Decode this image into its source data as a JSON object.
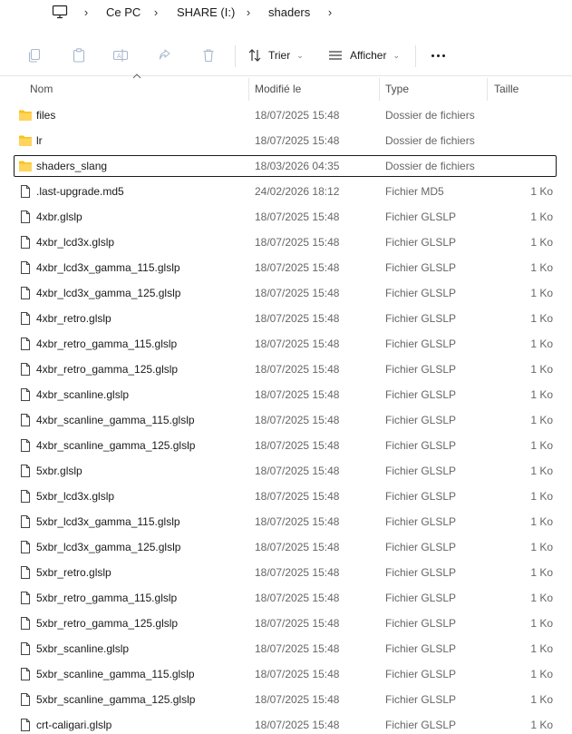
{
  "breadcrumb": {
    "segments": [
      "Ce PC",
      "SHARE (I:)",
      "shaders"
    ]
  },
  "toolbar": {
    "sort_label": "Trier",
    "view_label": "Afficher"
  },
  "columns": {
    "name": "Nom",
    "modified": "Modifié le",
    "type": "Type",
    "size": "Taille"
  },
  "colors": {
    "folder": "#F8C21C",
    "selection_border": "#1a1a1a",
    "secondary_text": "#666666"
  },
  "files": [
    {
      "kind": "folder",
      "name": "files",
      "modified": "18/07/2025 15:48",
      "type": "Dossier de fichiers",
      "size": ""
    },
    {
      "kind": "folder",
      "name": "lr",
      "modified": "18/07/2025 15:48",
      "type": "Dossier de fichiers",
      "size": ""
    },
    {
      "kind": "folder",
      "name": "shaders_slang",
      "modified": "18/03/2026 04:35",
      "type": "Dossier de fichiers",
      "size": "",
      "selected": true
    },
    {
      "kind": "file",
      "name": ".last-upgrade.md5",
      "modified": "24/02/2026 18:12",
      "type": "Fichier MD5",
      "size": "1 Ko"
    },
    {
      "kind": "file",
      "name": "4xbr.glslp",
      "modified": "18/07/2025 15:48",
      "type": "Fichier GLSLP",
      "size": "1 Ko"
    },
    {
      "kind": "file",
      "name": "4xbr_lcd3x.glslp",
      "modified": "18/07/2025 15:48",
      "type": "Fichier GLSLP",
      "size": "1 Ko"
    },
    {
      "kind": "file",
      "name": "4xbr_lcd3x_gamma_115.glslp",
      "modified": "18/07/2025 15:48",
      "type": "Fichier GLSLP",
      "size": "1 Ko"
    },
    {
      "kind": "file",
      "name": "4xbr_lcd3x_gamma_125.glslp",
      "modified": "18/07/2025 15:48",
      "type": "Fichier GLSLP",
      "size": "1 Ko"
    },
    {
      "kind": "file",
      "name": "4xbr_retro.glslp",
      "modified": "18/07/2025 15:48",
      "type": "Fichier GLSLP",
      "size": "1 Ko"
    },
    {
      "kind": "file",
      "name": "4xbr_retro_gamma_115.glslp",
      "modified": "18/07/2025 15:48",
      "type": "Fichier GLSLP",
      "size": "1 Ko"
    },
    {
      "kind": "file",
      "name": "4xbr_retro_gamma_125.glslp",
      "modified": "18/07/2025 15:48",
      "type": "Fichier GLSLP",
      "size": "1 Ko"
    },
    {
      "kind": "file",
      "name": "4xbr_scanline.glslp",
      "modified": "18/07/2025 15:48",
      "type": "Fichier GLSLP",
      "size": "1 Ko"
    },
    {
      "kind": "file",
      "name": "4xbr_scanline_gamma_115.glslp",
      "modified": "18/07/2025 15:48",
      "type": "Fichier GLSLP",
      "size": "1 Ko"
    },
    {
      "kind": "file",
      "name": "4xbr_scanline_gamma_125.glslp",
      "modified": "18/07/2025 15:48",
      "type": "Fichier GLSLP",
      "size": "1 Ko"
    },
    {
      "kind": "file",
      "name": "5xbr.glslp",
      "modified": "18/07/2025 15:48",
      "type": "Fichier GLSLP",
      "size": "1 Ko"
    },
    {
      "kind": "file",
      "name": "5xbr_lcd3x.glslp",
      "modified": "18/07/2025 15:48",
      "type": "Fichier GLSLP",
      "size": "1 Ko"
    },
    {
      "kind": "file",
      "name": "5xbr_lcd3x_gamma_115.glslp",
      "modified": "18/07/2025 15:48",
      "type": "Fichier GLSLP",
      "size": "1 Ko"
    },
    {
      "kind": "file",
      "name": "5xbr_lcd3x_gamma_125.glslp",
      "modified": "18/07/2025 15:48",
      "type": "Fichier GLSLP",
      "size": "1 Ko"
    },
    {
      "kind": "file",
      "name": "5xbr_retro.glslp",
      "modified": "18/07/2025 15:48",
      "type": "Fichier GLSLP",
      "size": "1 Ko"
    },
    {
      "kind": "file",
      "name": "5xbr_retro_gamma_115.glslp",
      "modified": "18/07/2025 15:48",
      "type": "Fichier GLSLP",
      "size": "1 Ko"
    },
    {
      "kind": "file",
      "name": "5xbr_retro_gamma_125.glslp",
      "modified": "18/07/2025 15:48",
      "type": "Fichier GLSLP",
      "size": "1 Ko"
    },
    {
      "kind": "file",
      "name": "5xbr_scanline.glslp",
      "modified": "18/07/2025 15:48",
      "type": "Fichier GLSLP",
      "size": "1 Ko"
    },
    {
      "kind": "file",
      "name": "5xbr_scanline_gamma_115.glslp",
      "modified": "18/07/2025 15:48",
      "type": "Fichier GLSLP",
      "size": "1 Ko"
    },
    {
      "kind": "file",
      "name": "5xbr_scanline_gamma_125.glslp",
      "modified": "18/07/2025 15:48",
      "type": "Fichier GLSLP",
      "size": "1 Ko"
    },
    {
      "kind": "file",
      "name": "crt-caligari.glslp",
      "modified": "18/07/2025 15:48",
      "type": "Fichier GLSLP",
      "size": "1 Ko"
    }
  ]
}
